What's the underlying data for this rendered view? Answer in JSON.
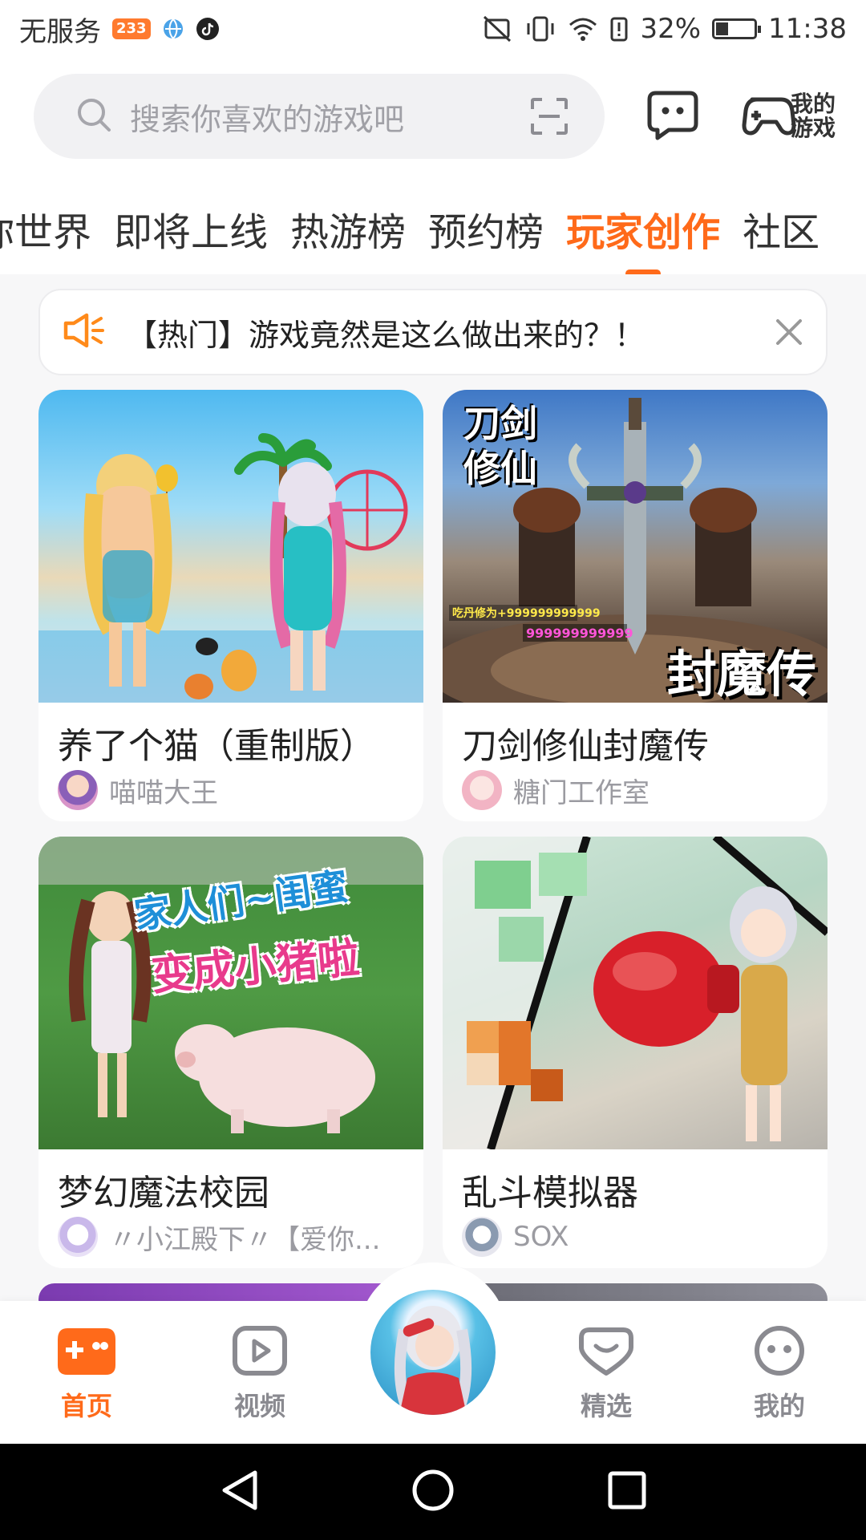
{
  "status_bar": {
    "carrier": "无服务",
    "badge": "233",
    "battery": "32%",
    "time": "11:38"
  },
  "search": {
    "placeholder": "搜索你喜欢的游戏吧"
  },
  "header": {
    "my_games_label": "我的游戏"
  },
  "tabs": [
    {
      "label": "你世界",
      "active": false
    },
    {
      "label": "即将上线",
      "active": false
    },
    {
      "label": "热游榜",
      "active": false
    },
    {
      "label": "预约榜",
      "active": false
    },
    {
      "label": "玩家创作",
      "active": true
    },
    {
      "label": "社区",
      "active": false
    }
  ],
  "notice": {
    "text": "【热门】游戏竟然是这么做出来的？！"
  },
  "games": [
    {
      "title": "养了个猫（重制版）",
      "author": "喵喵大王",
      "cover_text": ""
    },
    {
      "title": "刀剑修仙封魔传",
      "author": "糖门工作室",
      "cover_text_top": "刀剑修仙",
      "cover_text_bottom": "封魔传",
      "cover_small": "吃丹修为+999999999999",
      "cover_small2": "999999999999"
    },
    {
      "title": "梦幻魔法校园",
      "author": "〃小江殿下〃【爱你...",
      "cover_text_top": "家人们~闺蜜",
      "cover_text_bottom": "变成小猪啦"
    },
    {
      "title": "乱斗模拟器",
      "author": "SOX",
      "cover_text": ""
    }
  ],
  "bottom_nav": [
    {
      "label": "首页",
      "icon": "gamepad-icon",
      "active": true
    },
    {
      "label": "视频",
      "icon": "play-icon",
      "active": false
    },
    {
      "label": "精选",
      "icon": "heart-badge-icon",
      "active": false
    },
    {
      "label": "我的",
      "icon": "face-icon",
      "active": false
    }
  ],
  "colors": {
    "accent": "#ff6a1a",
    "background": "#f7f7f8",
    "muted_text": "#9b9ba1"
  }
}
